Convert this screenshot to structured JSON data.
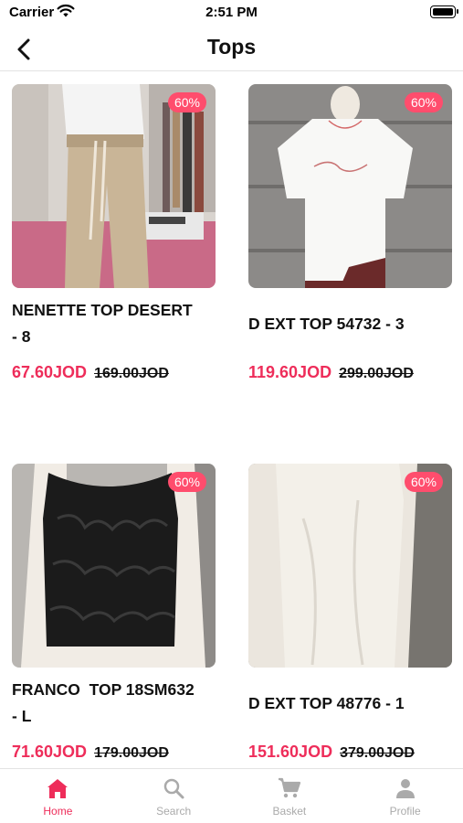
{
  "status_bar": {
    "carrier": "Carrier",
    "time": "2:51 PM"
  },
  "nav": {
    "title": "Tops",
    "back_icon": "chevron-left-icon"
  },
  "colors": {
    "accent": "#ee2d5a",
    "badge": "#ff4d6d",
    "tab_inactive": "#aaaaaa"
  },
  "products": [
    {
      "name": "NENETTE TOP DESERT - 8",
      "name_display": "NENETTE TOP DESERT\n- 8",
      "price": "67.60JOD",
      "old_price": "169.00JOD",
      "discount": "60%"
    },
    {
      "name": "D EXT TOP 54732 - 3",
      "name_display": "D EXT TOP 54732 - 3",
      "price": "119.60JOD",
      "old_price": "299.00JOD",
      "discount": "60%"
    },
    {
      "name": "FRANCO  TOP 18SM632 - L",
      "name_display": "FRANCO  TOP 18SM632\n- L",
      "price": "71.60JOD",
      "old_price": "179.00JOD",
      "discount": "60%"
    },
    {
      "name": "D EXT TOP 48776 - 1",
      "name_display": "D EXT TOP 48776 - 1",
      "price": "151.60JOD",
      "old_price": "379.00JOD",
      "discount": "60%"
    }
  ],
  "tab_bar": {
    "active": "Home",
    "items": [
      {
        "label": "Home",
        "icon": "home-icon"
      },
      {
        "label": "Search",
        "icon": "search-icon"
      },
      {
        "label": "Basket",
        "icon": "cart-icon"
      },
      {
        "label": "Profile",
        "icon": "profile-icon"
      }
    ]
  }
}
